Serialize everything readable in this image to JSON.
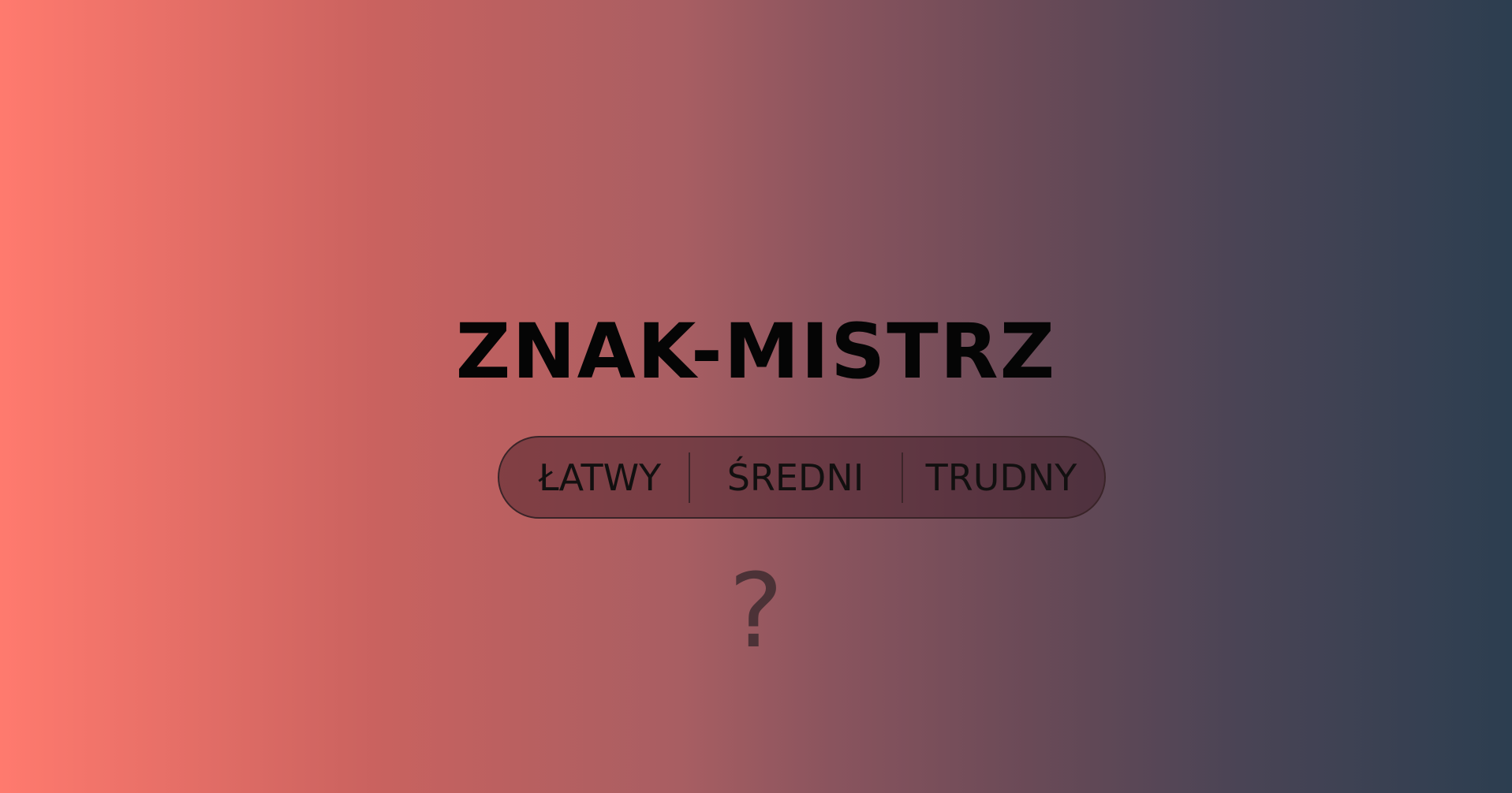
{
  "app": {
    "title": "ZNAK-MISTRZ"
  },
  "difficulty": {
    "options": [
      {
        "label": "ŁATWY"
      },
      {
        "label": "ŚREDNI"
      },
      {
        "label": "TRUDNY"
      }
    ]
  },
  "placeholder": {
    "symbol": "?",
    "icon": "question-mark-icon"
  },
  "colors": {
    "gradient_start": "#ff7a6e",
    "gradient_end": "#2c3e50",
    "title": "#050505"
  }
}
